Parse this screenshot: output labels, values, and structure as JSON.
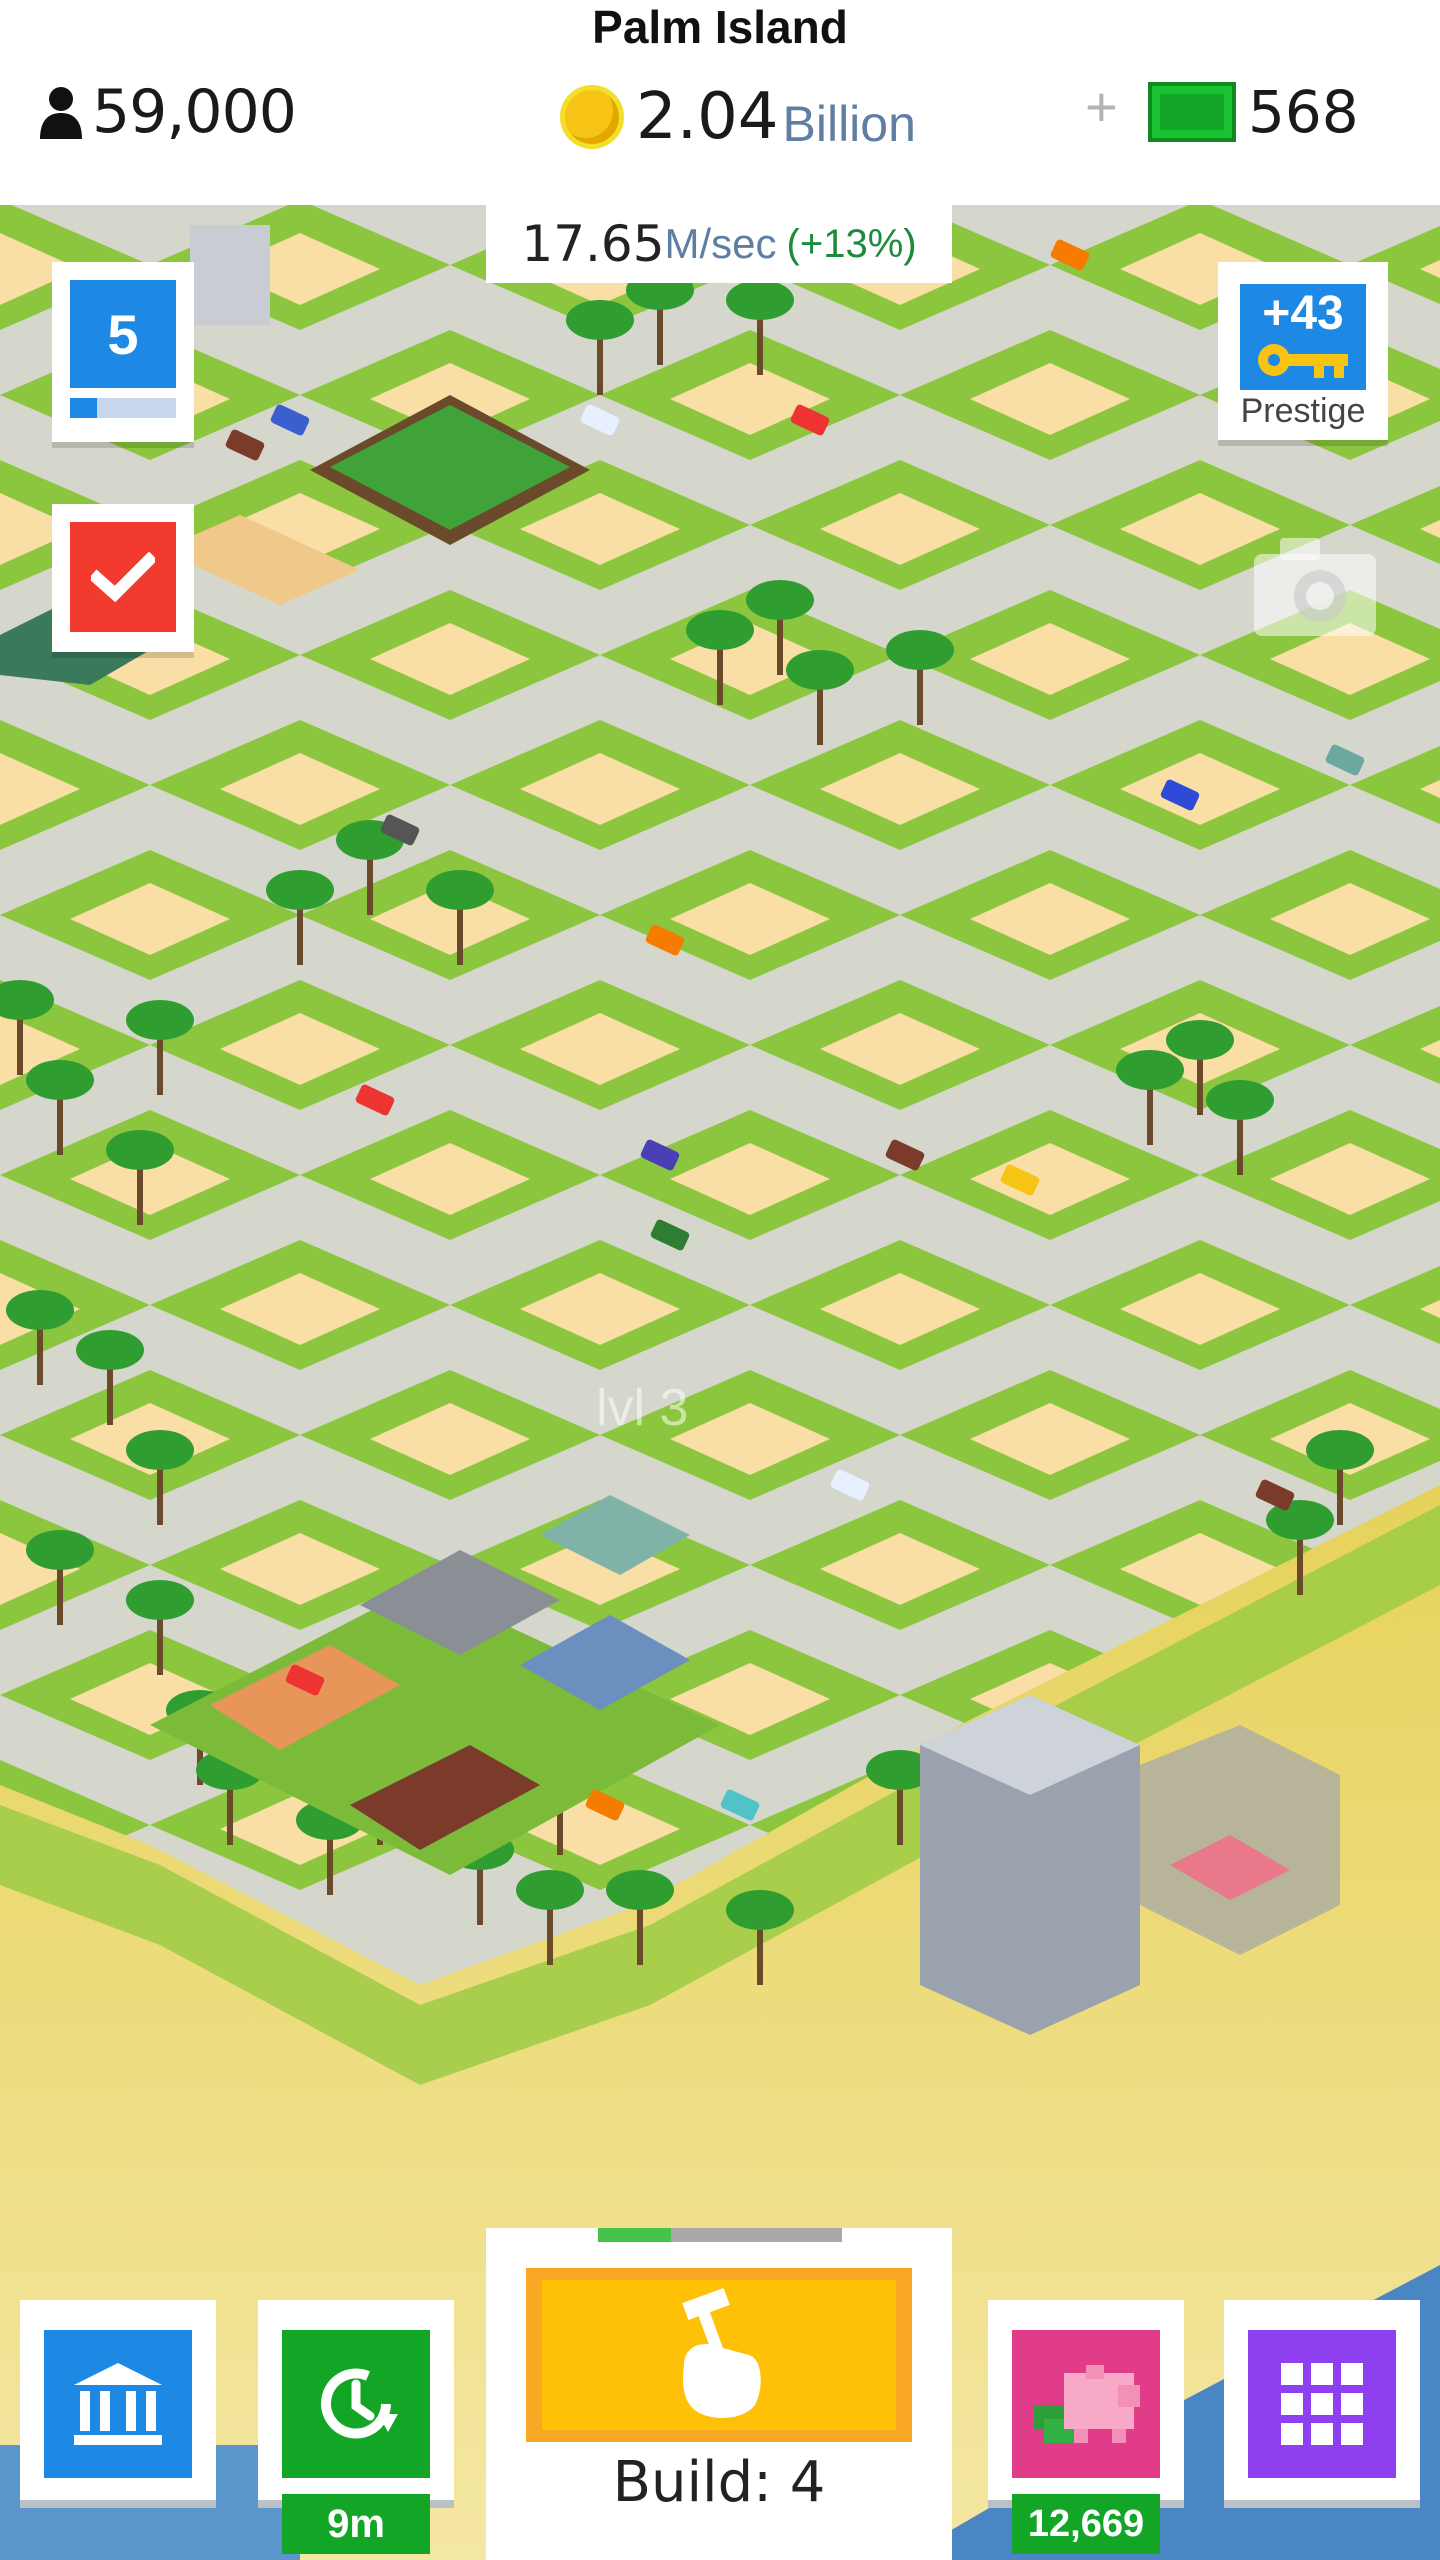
{
  "header": {
    "island_name": "Palm Island",
    "population": "59,000",
    "money_amount": "2.04",
    "money_unit": "Billion",
    "plus_symbol": "+",
    "cash": "568"
  },
  "income": {
    "value": "17.65",
    "unit": "M/sec",
    "bonus": "(+13%)"
  },
  "level": {
    "number": "5",
    "progress_fraction": 0.25
  },
  "prestige": {
    "amount": "+43",
    "label": "Prestige"
  },
  "map": {
    "building_level_label": "lvl 3"
  },
  "toolbar": {
    "bank_icon": "bank-icon",
    "time_warp_icon": "clock-arrow-icon",
    "time_warp_label": "9m",
    "build_label": "Build: 4",
    "build_progress_fraction": 0.3,
    "piggy_label": "12,669",
    "menu_icon": "grid-icon"
  },
  "colors": {
    "grass": "#8cc63f",
    "road": "#d5d6cc",
    "sand_lot": "#f9dea5",
    "blue_button": "#1e88e5",
    "green_button": "#12a526",
    "build_button": "#ffc107",
    "piggy_button": "#e03c8a",
    "menu_button": "#8e3ff0"
  }
}
